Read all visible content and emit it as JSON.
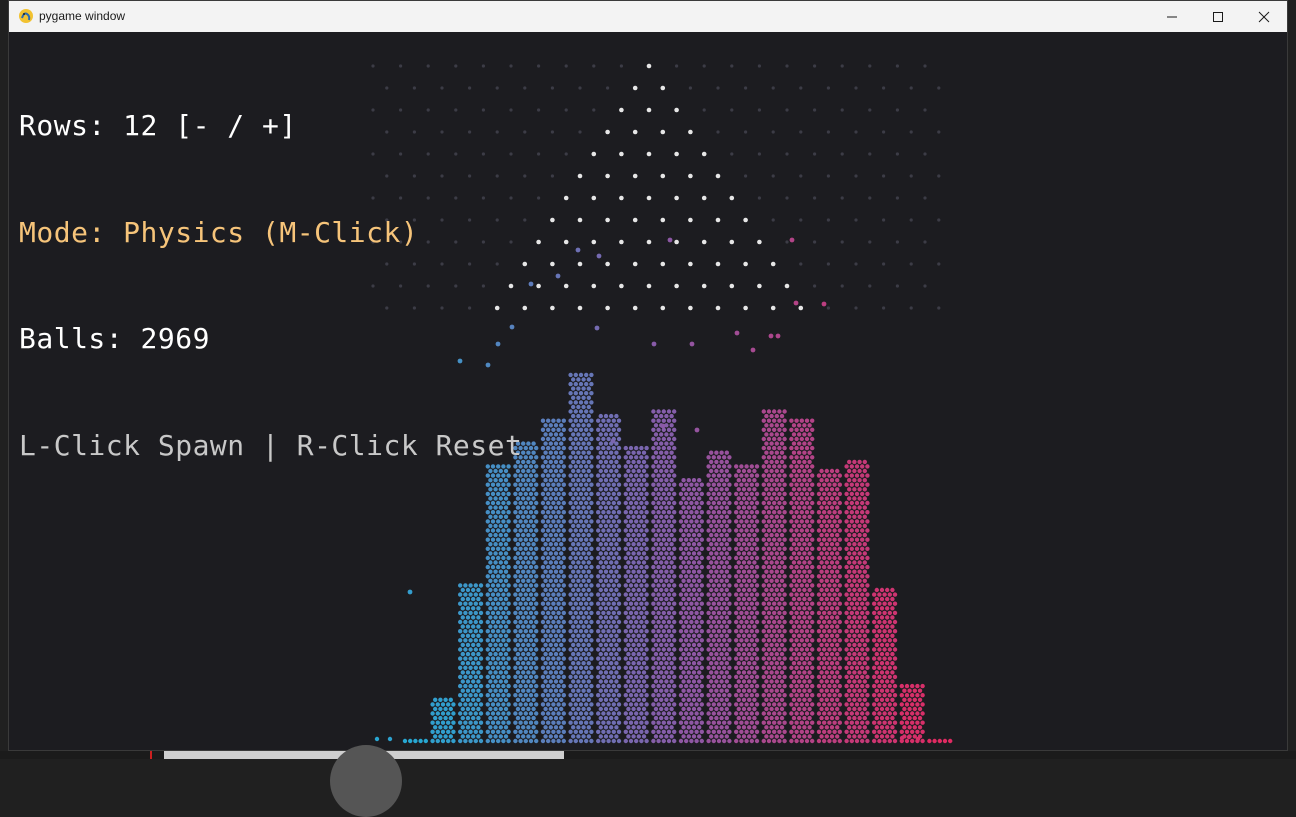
{
  "window": {
    "title": "pygame window",
    "icon": "pygame-snake-icon",
    "controls": {
      "minimize_icon": "minimize-icon",
      "maximize_icon": "maximize-icon",
      "close_icon": "close-icon"
    }
  },
  "hud": {
    "rows_text": "Rows: 12 [- / +]",
    "mode_text": "Mode: Physics (M-Click)",
    "balls_text": "Balls: 2969",
    "help_text": "L-Click Spawn | R-Click Reset"
  },
  "simulation": {
    "rows": 12,
    "mode": "Physics",
    "balls": 2969
  },
  "colors": {
    "background": "#1c1c20",
    "titlebar": "#f3f3f3",
    "mode_text": "#f6c47a",
    "peg": "#e6e6e6",
    "peg_dim": "#3c3c46",
    "gradient_left": "#27a7d2",
    "gradient_mid": "#8a5aa8",
    "gradient_right": "#e02a62"
  }
}
